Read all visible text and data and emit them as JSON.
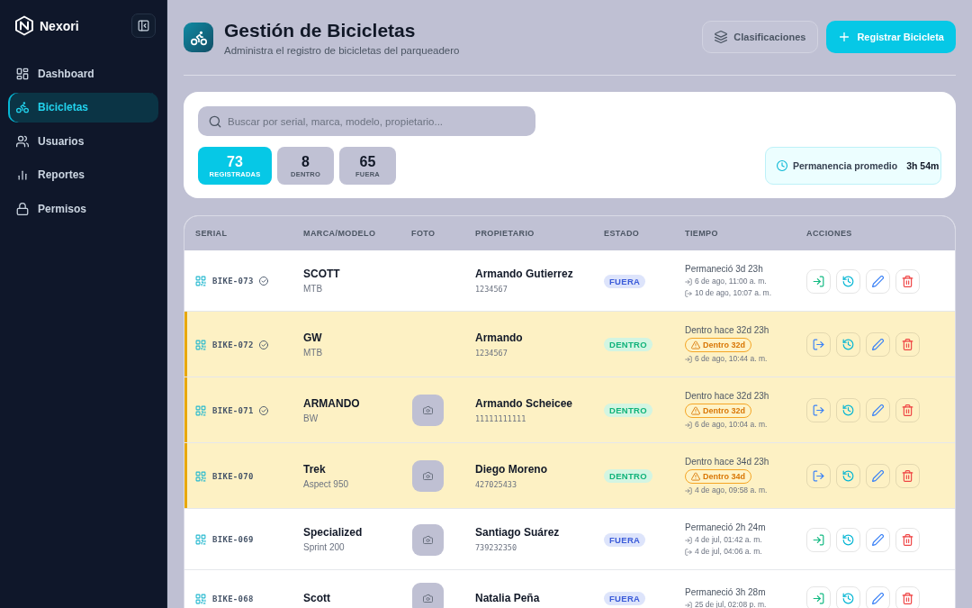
{
  "sidebar": {
    "brand": "Nexori",
    "items": [
      {
        "label": "Dashboard",
        "selected": false
      },
      {
        "label": "Bicicletas",
        "selected": true
      },
      {
        "label": "Usuarios",
        "selected": false
      },
      {
        "label": "Reportes",
        "selected": false
      },
      {
        "label": "Permisos",
        "selected": false
      }
    ]
  },
  "header": {
    "title": "Gestión de Bicicletas",
    "subtitle": "Administra el registro de bicicletas del parqueadero",
    "buttons": [
      {
        "label": "Clasificaciones",
        "kind": "secondary"
      },
      {
        "label": "Registrar Bicicleta",
        "kind": "primary"
      }
    ]
  },
  "filters": {
    "search": {
      "placeholder": "Buscar por serial, marca, modelo, propietario..."
    },
    "stats": [
      {
        "value": "73",
        "label": "REGISTRADAS",
        "selected": true
      },
      {
        "value": "8",
        "label": "DENTRO",
        "selected": false
      },
      {
        "value": "65",
        "label": "FUERA",
        "selected": false
      }
    ],
    "average": {
      "label": "Permanencia promedio",
      "value": "3h 54m"
    }
  },
  "table": {
    "columns": [
      "SERIAL",
      "MARCA/MODELO",
      "FOTO",
      "PROPIETARIO",
      "ESTADO",
      "TIEMPO",
      "ACCIONES"
    ],
    "rows": [
      {
        "serial": "BIKE-073",
        "verified": true,
        "brand": "SCOTT",
        "model": "MTB",
        "has_photo": false,
        "owner": "Armando Gutierrez",
        "document": "1234567",
        "status": "FUERA",
        "inside": false,
        "time": "Permaneció 3d 23h",
        "entry": "6 de ago, 11:00 a. m.",
        "exit": "10 de ago, 10:07 a. m."
      },
      {
        "serial": "BIKE-072",
        "verified": true,
        "brand": "GW",
        "model": "MTB",
        "has_photo": false,
        "owner": "Armando",
        "document": "1234567",
        "status": "DENTRO",
        "inside": true,
        "time": "Dentro hace 32d 23h",
        "warning": "Dentro 32d",
        "entry": "6 de ago, 10:44 a. m."
      },
      {
        "serial": "BIKE-071",
        "verified": true,
        "brand": "ARMANDO",
        "model": "BW",
        "has_photo": true,
        "owner": "Armando Scheicee",
        "document": "11111111111",
        "status": "DENTRO",
        "inside": true,
        "time": "Dentro hace 32d 23h",
        "warning": "Dentro 32d",
        "entry": "6 de ago, 10:04 a. m."
      },
      {
        "serial": "BIKE-070",
        "verified": false,
        "brand": "Trek",
        "model": "Aspect 950",
        "has_photo": true,
        "owner": "Diego Moreno",
        "document": "427025433",
        "status": "DENTRO",
        "inside": true,
        "time": "Dentro hace 34d 23h",
        "warning": "Dentro 34d",
        "entry": "4 de ago, 09:58 a. m."
      },
      {
        "serial": "BIKE-069",
        "verified": false,
        "brand": "Specialized",
        "model": "Sprint 200",
        "has_photo": true,
        "owner": "Santiago Suárez",
        "document": "739232350",
        "status": "FUERA",
        "inside": false,
        "time": "Permaneció 2h 24m",
        "entry": "4 de jul, 01:42 a. m.",
        "exit": "4 de jul, 04:06 a. m."
      },
      {
        "serial": "BIKE-068",
        "verified": false,
        "brand": "Scott",
        "has_photo": true,
        "owner": "Natalia Peña",
        "status": "FUERA",
        "inside": false,
        "time": "Permaneció 3h 28m",
        "entry": "25 de jul, 02:08 p. m."
      }
    ]
  }
}
